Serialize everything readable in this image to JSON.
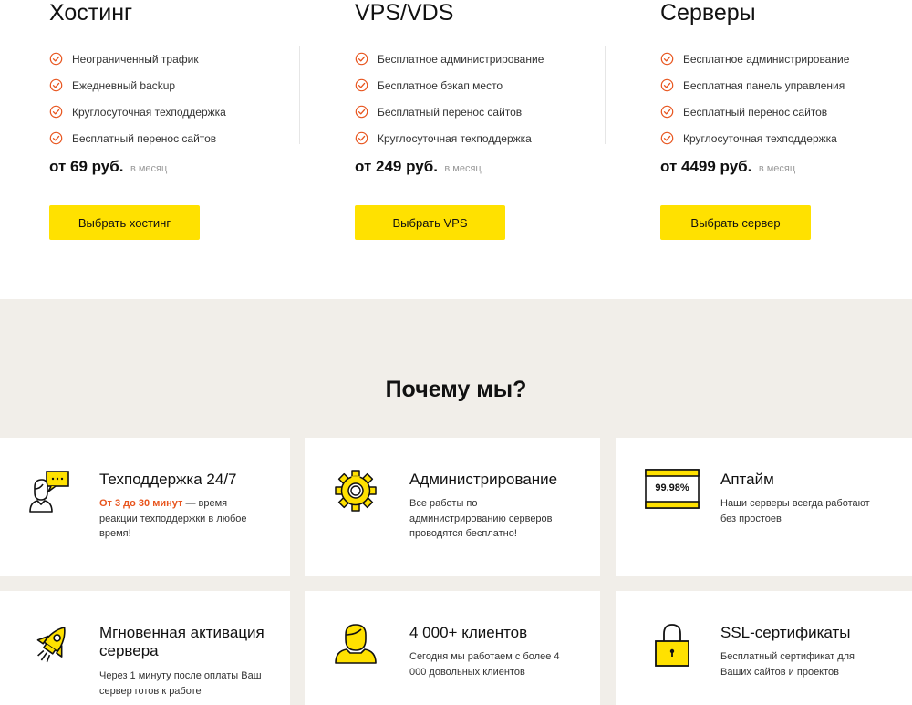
{
  "plans": [
    {
      "title": "Хостинг",
      "features": [
        "Неограниченный трафик",
        "Ежедневный backup",
        "Круглосуточная техподдержка",
        "Бесплатный перенос сайтов"
      ],
      "price": "от 69 руб.",
      "price_unit": "в месяц",
      "button": "Выбрать хостинг"
    },
    {
      "title": "VPS/VDS",
      "features": [
        "Бесплатное администрирование",
        "Бесплатное бэкап место",
        "Бесплатный перенос сайтов",
        "Круглосуточная техподдержка"
      ],
      "price": "от 249 руб.",
      "price_unit": "в месяц",
      "button": "Выбрать VPS"
    },
    {
      "title": "Серверы",
      "features": [
        "Бесплатное администрирование",
        "Бесплатная панель управления",
        "Бесплатный перенос сайтов",
        "Круглосуточная техподдержка"
      ],
      "price": "от 4499 руб.",
      "price_unit": "в месяц",
      "button": "Выбрать сервер"
    }
  ],
  "why": {
    "title": "Почему мы?",
    "cards": [
      {
        "icon": "support-chat-icon",
        "title": "Техподдержка 24/7",
        "highlight": "От 3 до 30 минут",
        "desc": " — время реакции техподдержки в любое время!"
      },
      {
        "icon": "gear-icon",
        "title": "Администрирование",
        "desc": "Все работы по администрированию серверов проводятся бесплатно!"
      },
      {
        "icon": "uptime-display-icon",
        "title": "Аптайм",
        "icon_text": "99,98%",
        "desc": "Наши серверы всегда работают без простоев"
      },
      {
        "icon": "rocket-icon",
        "title": "Мгновенная активация сервера",
        "desc": "Через 1 минуту после оплаты Ваш сервер готов к работе"
      },
      {
        "icon": "user-icon",
        "title": "4 000+ клиентов",
        "desc": "Сегодня мы работаем с более 4 000 довольных клиентов"
      },
      {
        "icon": "padlock-icon",
        "title": "SSL-сертификаты",
        "desc": "Бесплатный сертификат для Ваших сайтов и проектов"
      }
    ]
  },
  "colors": {
    "accent": "#ffe100",
    "check": "#e8551e",
    "section_bg": "#f1eee9"
  }
}
